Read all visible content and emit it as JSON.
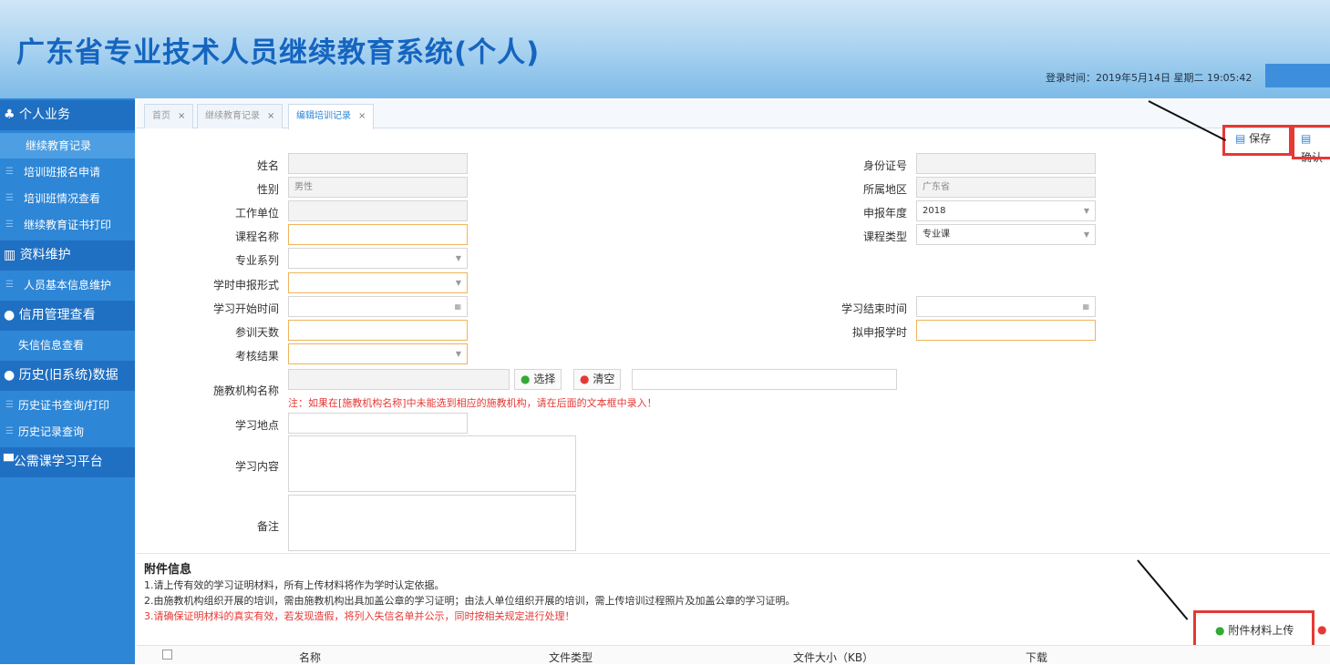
{
  "header": {
    "title": "广东省专业技术人员继续教育系统(个人)",
    "login_time": "登录时间：2019年5月14日  星期二  19:05:42"
  },
  "sidebar": {
    "sections": [
      {
        "label": "个人业务",
        "items": [
          "继续教育记录",
          "培训班报名申请",
          "培训班情况查看",
          "继续教育证书打印"
        ]
      },
      {
        "label": "资料维护",
        "items": [
          "人员基本信息维护"
        ]
      },
      {
        "label": "信用管理查看",
        "items": [
          "失信信息查看"
        ]
      },
      {
        "label": "历史(旧系统)数据",
        "items": [
          "历史证书查询/打印",
          "历史记录查询"
        ]
      },
      {
        "label": "公需课学习平台",
        "items": []
      }
    ],
    "selected": "继续教育记录"
  },
  "tabs": [
    {
      "label": "首页"
    },
    {
      "label": "继续教育记录"
    },
    {
      "label": "编辑培训记录",
      "active": true
    }
  ],
  "toolbar": {
    "save": "保存",
    "confirm": "确认"
  },
  "form": {
    "name": "姓名",
    "id_no": "身份证号",
    "gender": "性别",
    "gender_value": "男性",
    "region": "所属地区",
    "region_value": "广东省",
    "employer": "工作单位",
    "year": "申报年度",
    "year_value": "2018",
    "course_name": "课程名称",
    "course_type": "课程类型",
    "course_type_value": "专业课",
    "major_series": "专业系列",
    "hour_form": "学时申报形式",
    "start_time": "学习开始时间",
    "end_time": "学习结束时间",
    "days": "参训天数",
    "planned_hours": "拟申报学时",
    "exam_result": "考核结果",
    "institution": "施教机构名称",
    "select": "选择",
    "clear": "清空",
    "institution_note": "注：如果在[施教机构名称]中未能选到相应的施教机构，请在后面的文本框中录入！",
    "location": "学习地点",
    "content": "学习内容",
    "remark": "备注"
  },
  "attachments": {
    "title": "附件信息",
    "notes": [
      "1.请上传有效的学习证明材料，所有上传材料将作为学时认定依据。",
      "2.由施教机构组织开展的培训，需由施教机构出具加盖公章的学习证明；由法人单位组织开展的培训，需上传培训过程照片及加盖公章的学习证明。"
    ],
    "warning": "3.请确保证明材料的真实有效，若发现造假，将列入失信名单并公示，同时按相关规定进行处理！",
    "upload": "附件材料上传",
    "columns": [
      "名称",
      "文件类型",
      "文件大小（KB）",
      "下载"
    ]
  },
  "colors": {
    "accent": "#2d86d6",
    "highlight": "#e53935",
    "required_border": "#f0b45a"
  }
}
